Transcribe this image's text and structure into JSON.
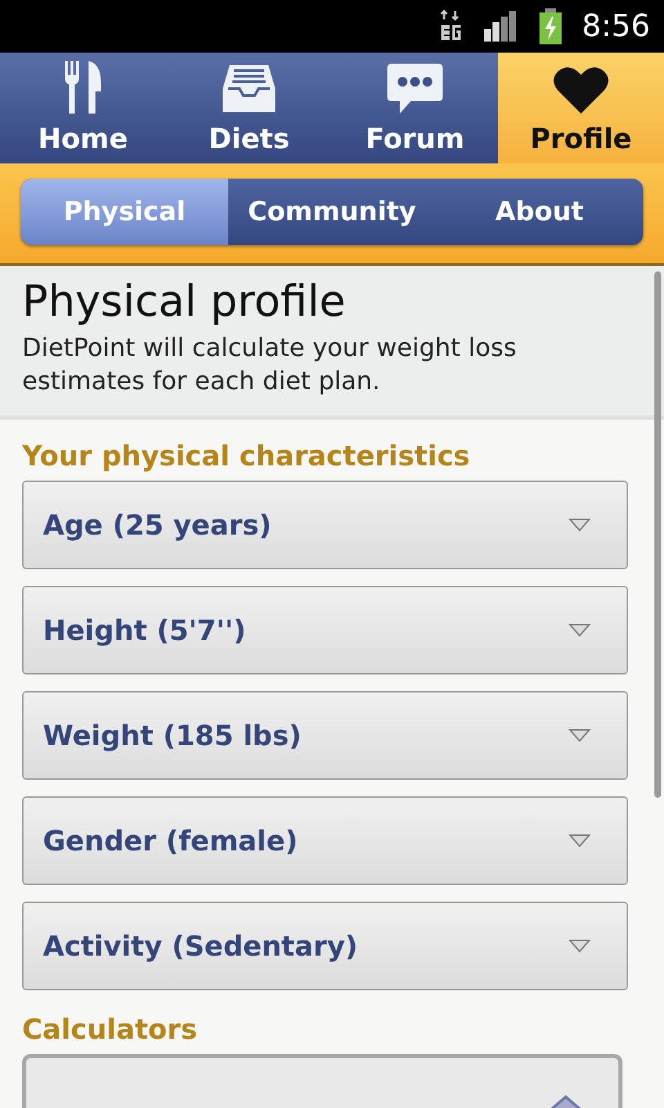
{
  "status_bar": {
    "time": "8:56"
  },
  "tabs": [
    {
      "label": "Home",
      "selected": false
    },
    {
      "label": "Diets",
      "selected": false
    },
    {
      "label": "Forum",
      "selected": false
    },
    {
      "label": "Profile",
      "selected": true
    }
  ],
  "subtabs": [
    {
      "label": "Physical",
      "selected": true
    },
    {
      "label": "Community",
      "selected": false
    },
    {
      "label": "About",
      "selected": false
    }
  ],
  "header": {
    "title": "Physical profile",
    "description": "DietPoint will calculate your weight loss estimates for each diet plan."
  },
  "characteristics": {
    "heading": "Your physical characteristics",
    "fields": [
      {
        "value": "Age (25 years)"
      },
      {
        "value": "Height (5'7'')"
      },
      {
        "value": "Weight (185 lbs)"
      },
      {
        "value": "Gender (female)"
      },
      {
        "value": "Activity (Sedentary)"
      }
    ]
  },
  "calculators": {
    "heading": "Calculators"
  }
}
